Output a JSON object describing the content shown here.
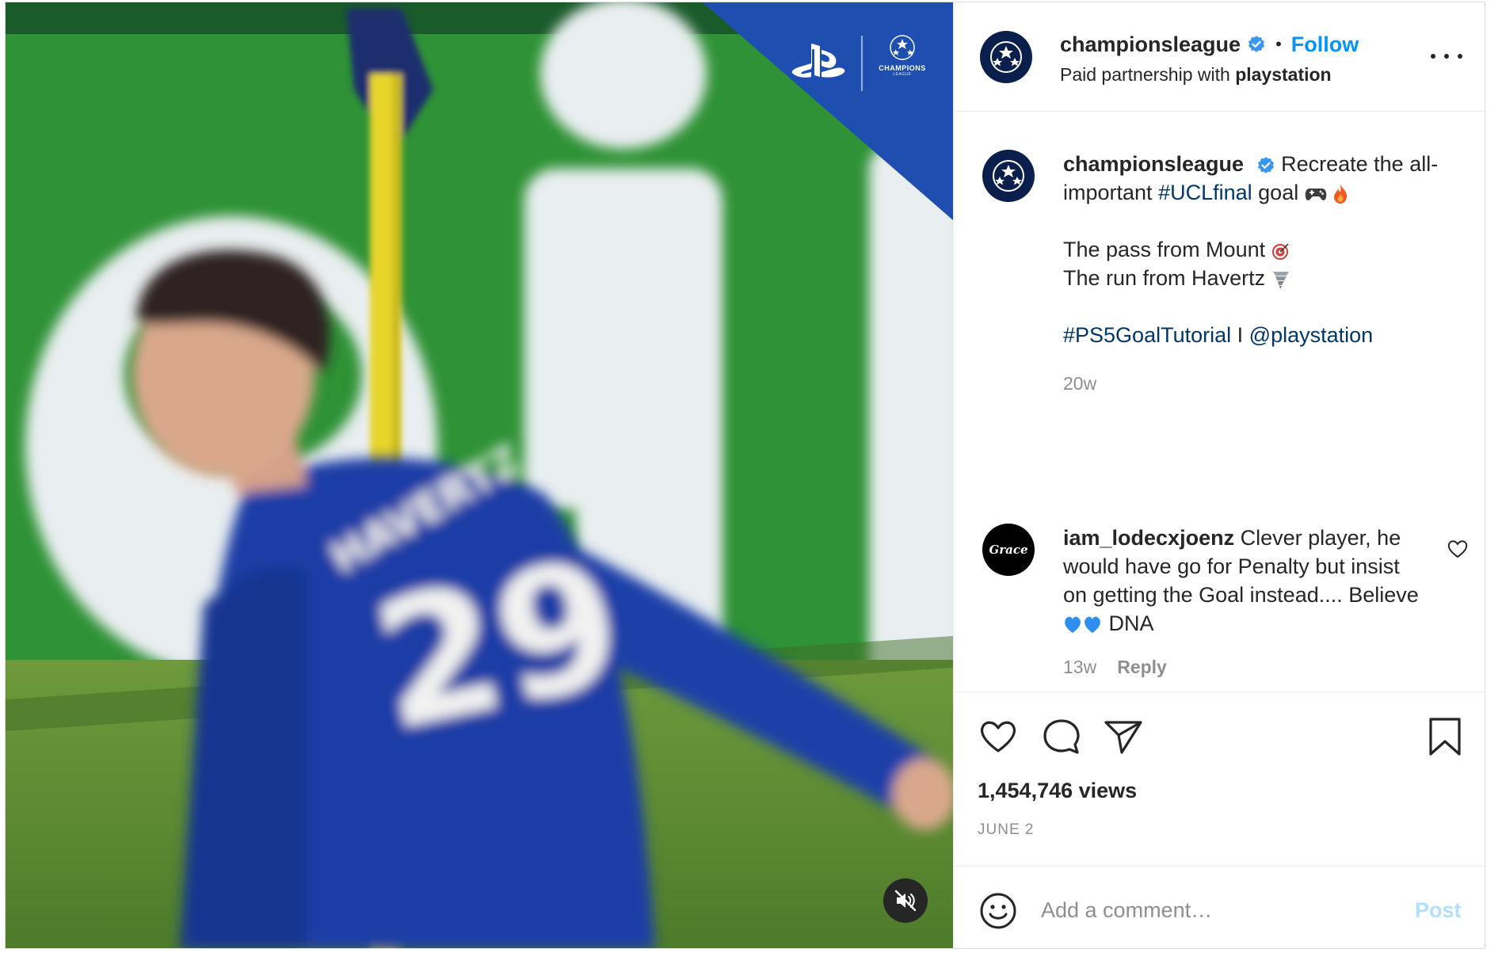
{
  "header": {
    "username": "championsleague",
    "separator": "•",
    "follow_label": "Follow",
    "partnership_prefix": "Paid partnership with",
    "partner": "playstation"
  },
  "media": {
    "brand_text": "CHAMPIONS",
    "brand_subtext": "LEAGUE"
  },
  "caption": {
    "username": "championsleague",
    "line1_text": "Recreate the all-important",
    "hashtag1": "#UCLfinal",
    "line1_suffix": "goal",
    "line2": "The pass from Mount",
    "line3": "The run from Havertz",
    "hashtag2": "#PS5GoalTutorial",
    "separator": "I",
    "mention": "@playstation",
    "time": "20w"
  },
  "comment": {
    "avatar_text": "Grace",
    "username": "iam_lodecxjoenz",
    "text_part1": "Clever player, he would have go for Penalty but insist on getting the Goal instead.... Believe",
    "text_part2": "DNA",
    "time": "13w",
    "reply_label": "Reply"
  },
  "stats": {
    "views": "1,454,746 views",
    "date": "JUNE 2"
  },
  "comment_input": {
    "placeholder": "Add a comment…",
    "post_label": "Post"
  },
  "colors": {
    "accent": "#0095f6",
    "link": "#00376b",
    "muted": "#8e8e8e",
    "post_disabled": "#b2dffc",
    "verified": "#3897f0"
  },
  "icons": {
    "verified": "verified-badge-icon",
    "more": "more-options-icon",
    "like": "heart-icon",
    "comment": "comment-bubble-icon",
    "share": "paper-plane-icon",
    "save": "bookmark-icon",
    "emoji": "smiley-icon",
    "mute": "speaker-muted-icon"
  }
}
